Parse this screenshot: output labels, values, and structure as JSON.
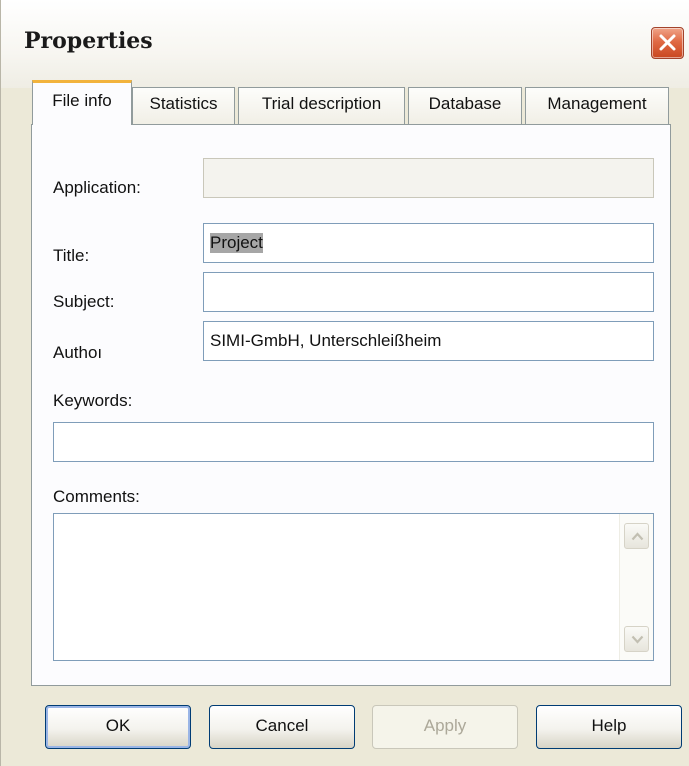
{
  "window": {
    "title": "Properties"
  },
  "tabs": [
    {
      "label": "File info",
      "active": true
    },
    {
      "label": "Statistics",
      "active": false
    },
    {
      "label": "Trial description",
      "active": false
    },
    {
      "label": "Database",
      "active": false
    },
    {
      "label": "Management",
      "active": false
    }
  ],
  "form": {
    "application": {
      "label": "Application:",
      "value": ""
    },
    "title": {
      "label": "Title:",
      "value": "Project"
    },
    "subject": {
      "label": "Subject:",
      "value": ""
    },
    "author": {
      "label": "Authoı",
      "value": "SIMI-GmbH, Unterschleißheim"
    },
    "keywords": {
      "label": "Keywords:",
      "value": ""
    },
    "comments": {
      "label": "Comments:",
      "value": ""
    }
  },
  "buttons": {
    "ok": "OK",
    "cancel": "Cancel",
    "apply": "Apply",
    "help": "Help"
  },
  "colors": {
    "window_bg": "#ece9d8",
    "panel_bg": "#fcfcfe",
    "active_tab_accent": "#f2b33c",
    "close_button": "#e06a45",
    "field_border": "#7f9db9"
  },
  "icons": {
    "close": "close-icon",
    "scroll_up": "scroll-up-arrow-icon",
    "scroll_down": "scroll-down-arrow-icon"
  }
}
